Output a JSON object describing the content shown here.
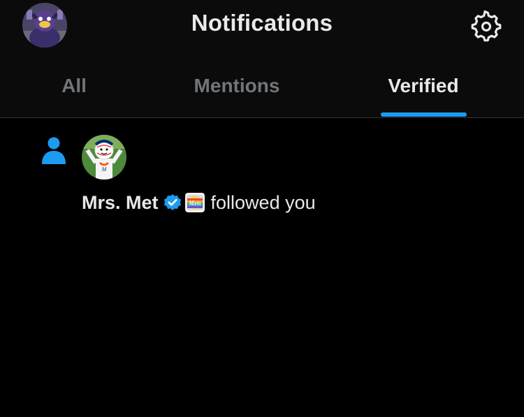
{
  "header": {
    "title": "Notifications",
    "profile_avatar_icon": "user-avatar-mascot",
    "settings_icon": "gear-icon"
  },
  "tabs": [
    {
      "label": "All",
      "active": false
    },
    {
      "label": "Mentions",
      "active": false
    },
    {
      "label": "Verified",
      "active": true
    }
  ],
  "notifications": [
    {
      "type_icon": "person-icon",
      "avatar_icon": "mrs-met-avatar",
      "name": "Mrs. Met",
      "verified": true,
      "affiliate_badge_icon": "mets-affiliate-badge",
      "action": "followed you"
    }
  ],
  "colors": {
    "accent": "#1d9bf0",
    "background": "#000000",
    "header_background": "#0b0b0b",
    "text_primary": "#e7e9ea",
    "text_secondary": "#71767b"
  }
}
